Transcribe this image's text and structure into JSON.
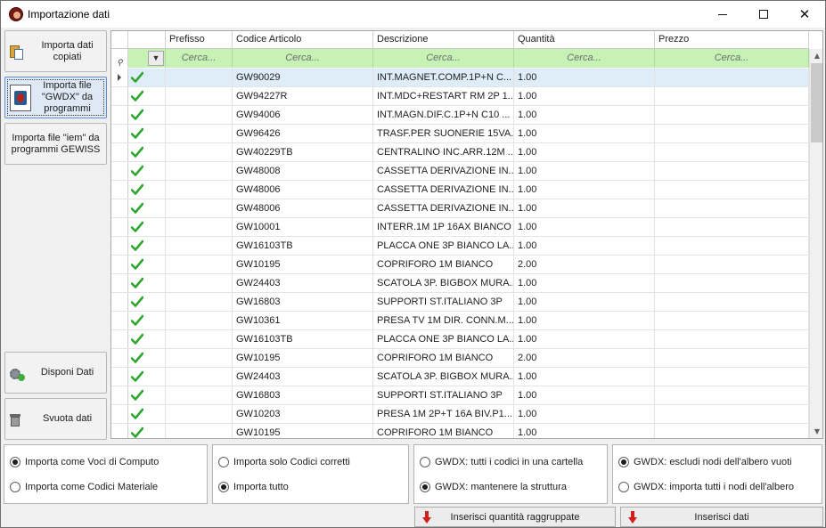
{
  "window": {
    "title": "Importazione dati",
    "controls": {
      "minimize": "minimize-icon",
      "maximize": "maximize-icon",
      "close": "close-icon"
    }
  },
  "sidebar": {
    "import_copied": "Importa dati copiati",
    "import_gwdx": "Importa file \"GWDX\" da programmi",
    "import_iem": "Importa file \"iem\" da programmi GEWISS",
    "arrange": "Disponi Dati",
    "clear": "Svuota dati"
  },
  "grid": {
    "columns": [
      "Prefisso",
      "Codice Articolo",
      "Descrizione",
      "Quantità",
      "Prezzo"
    ],
    "filter_placeholder": "Cerca...",
    "rows": [
      {
        "prefix": "",
        "code": "GW90029",
        "description": "INT.MAGNET.COMP.1P+N C...",
        "qty": "1.00",
        "price": ""
      },
      {
        "prefix": "",
        "code": "GW94227R",
        "description": "INT.MDC+RESTART RM 2P 1...",
        "qty": "1.00",
        "price": ""
      },
      {
        "prefix": "",
        "code": "GW94006",
        "description": "INT.MAGN.DIF.C.1P+N C10 ...",
        "qty": "1.00",
        "price": ""
      },
      {
        "prefix": "",
        "code": "GW96426",
        "description": "TRASF.PER SUONERIE 15VA...",
        "qty": "1.00",
        "price": ""
      },
      {
        "prefix": "",
        "code": "GW40229TB",
        "description": "CENTRALINO INC.ARR.12M ...",
        "qty": "1.00",
        "price": ""
      },
      {
        "prefix": "",
        "code": "GW48008",
        "description": "CASSETTA DERIVAZIONE IN...",
        "qty": "1.00",
        "price": ""
      },
      {
        "prefix": "",
        "code": "GW48006",
        "description": "CASSETTA DERIVAZIONE IN...",
        "qty": "1.00",
        "price": ""
      },
      {
        "prefix": "",
        "code": "GW48006",
        "description": "CASSETTA DERIVAZIONE IN...",
        "qty": "1.00",
        "price": ""
      },
      {
        "prefix": "",
        "code": "GW10001",
        "description": "INTERR.1M 1P 16AX BIANCO",
        "qty": "1.00",
        "price": ""
      },
      {
        "prefix": "",
        "code": "GW16103TB",
        "description": "PLACCA ONE 3P BIANCO LA...",
        "qty": "1.00",
        "price": ""
      },
      {
        "prefix": "",
        "code": "GW10195",
        "description": "COPRIFORO 1M BIANCO",
        "qty": "2.00",
        "price": ""
      },
      {
        "prefix": "",
        "code": "GW24403",
        "description": "SCATOLA 3P. BIGBOX MURA...",
        "qty": "1.00",
        "price": ""
      },
      {
        "prefix": "",
        "code": "GW16803",
        "description": "SUPPORTI ST.ITALIANO 3P",
        "qty": "1.00",
        "price": ""
      },
      {
        "prefix": "",
        "code": "GW10361",
        "description": "PRESA TV 1M DIR. CONN.M...",
        "qty": "1.00",
        "price": ""
      },
      {
        "prefix": "",
        "code": "GW16103TB",
        "description": "PLACCA ONE 3P BIANCO LA...",
        "qty": "1.00",
        "price": ""
      },
      {
        "prefix": "",
        "code": "GW10195",
        "description": "COPRIFORO 1M BIANCO",
        "qty": "2.00",
        "price": ""
      },
      {
        "prefix": "",
        "code": "GW24403",
        "description": "SCATOLA 3P. BIGBOX MURA...",
        "qty": "1.00",
        "price": ""
      },
      {
        "prefix": "",
        "code": "GW16803",
        "description": "SUPPORTI ST.ITALIANO 3P",
        "qty": "1.00",
        "price": ""
      },
      {
        "prefix": "",
        "code": "GW10203",
        "description": "PRESA 1M 2P+T 16A BIV.P1...",
        "qty": "1.00",
        "price": ""
      },
      {
        "prefix": "",
        "code": "GW10195",
        "description": "COPRIFORO 1M BIANCO",
        "qty": "1.00",
        "price": ""
      }
    ],
    "selected_row": 0,
    "row_status_icon": "check-icon",
    "scroll_position": 0.0,
    "scroll_visible_fraction": 0.22
  },
  "options": {
    "group1": [
      {
        "label": "Importa come Voci di Computo",
        "checked": true
      },
      {
        "label": "Importa come Codici Materiale",
        "checked": false
      }
    ],
    "group2": [
      {
        "label": "Importa solo Codici corretti",
        "checked": false
      },
      {
        "label": "Importa tutto",
        "checked": true
      }
    ],
    "group3": [
      {
        "label": "GWDX: tutti i codici in una cartella",
        "checked": false
      },
      {
        "label": "GWDX: mantenere la struttura",
        "checked": true
      }
    ],
    "group4": [
      {
        "label": "GWDX: escludi nodi dell'albero vuoti",
        "checked": true
      },
      {
        "label": "GWDX: importa tutti i nodi dell'albero",
        "checked": false
      }
    ]
  },
  "actions": {
    "insert_grouped": "Inserisci quantità raggruppate",
    "insert_data": "Inserisci dati"
  },
  "colors": {
    "filter_bg": "#c6f2b6",
    "selected_row": "#dfedf9",
    "check": "#2fa62f",
    "arrow": "#d0201a"
  }
}
